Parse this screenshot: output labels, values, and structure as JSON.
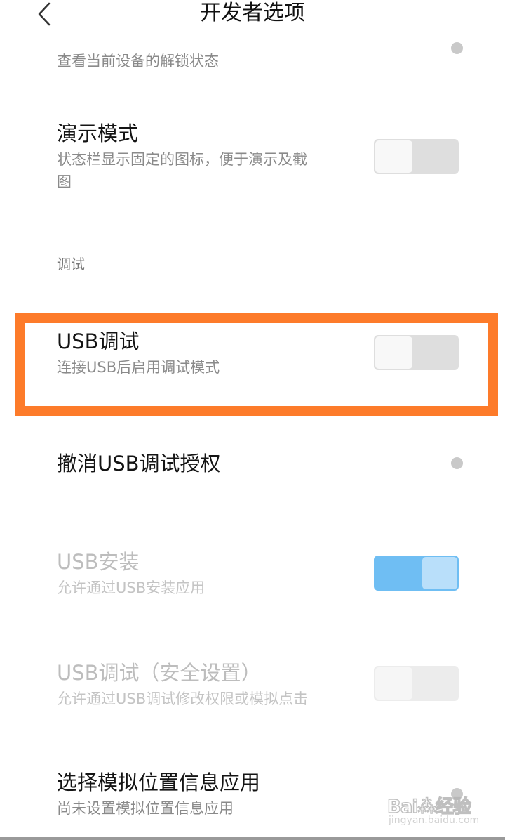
{
  "header": {
    "title": "开发者选项",
    "back_icon": "chevron-left-icon"
  },
  "items": {
    "unlock_status": {
      "subtitle": "查看当前设备的解锁状态"
    },
    "demo_mode": {
      "title": "演示模式",
      "subtitle_line1": "状态栏显示固定的图标，便于演示及截",
      "subtitle_line2": "图",
      "toggle_on": false
    },
    "section_debug": "调试",
    "usb_debug": {
      "title": "USB调试",
      "subtitle": "连接USB后启用调试模式",
      "toggle_on": false
    },
    "revoke_usb": {
      "title": "撤消USB调试授权"
    },
    "usb_install": {
      "title": "USB安装",
      "subtitle": "允许通过USB安装应用",
      "toggle_on": true,
      "enabled": false
    },
    "usb_debug_secure": {
      "title": "USB调试（安全设置）",
      "subtitle": "允许通过USB调试修改权限或模拟点击",
      "toggle_on": false,
      "enabled": false
    },
    "mock_location": {
      "title": "选择模拟位置信息应用",
      "subtitle": "尚未设置模拟位置信息应用"
    }
  },
  "watermark": {
    "logo_text": "Bai⁂经验",
    "url": "jingyan.baidu.com"
  },
  "colors": {
    "highlight": "#fd7b2a",
    "toggle_on": "#6fbef3",
    "toggle_off": "#dedede"
  }
}
